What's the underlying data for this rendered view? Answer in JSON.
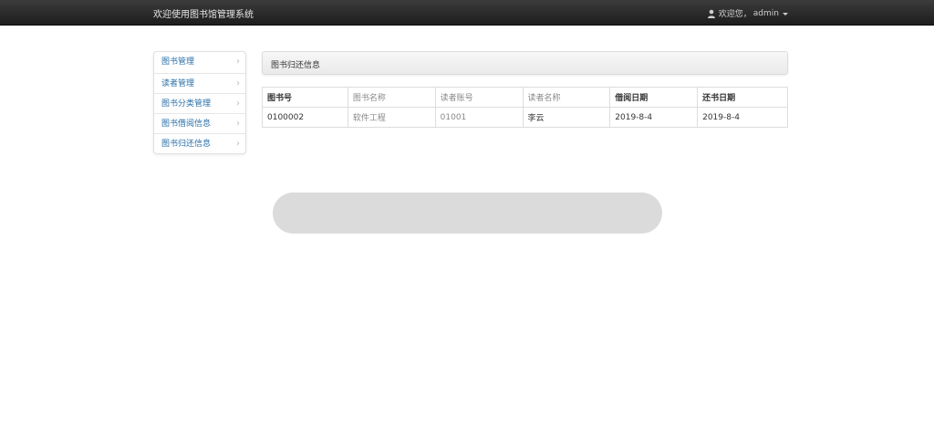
{
  "navbar": {
    "brand": "欢迎使用图书馆管理系统",
    "user_greeting": "欢迎您，",
    "user_name": "admin"
  },
  "sidebar": {
    "items": [
      {
        "label": "图书管理"
      },
      {
        "label": "读者管理"
      },
      {
        "label": "图书分类管理"
      },
      {
        "label": "图书借阅信息"
      },
      {
        "label": "图书归还信息"
      }
    ]
  },
  "panel": {
    "title": "图书归还信息"
  },
  "table": {
    "headers": [
      "图书号",
      "图书名称",
      "读者账号",
      "读者名称",
      "借阅日期",
      "还书日期"
    ],
    "rows": [
      [
        "0100002",
        "软件工程",
        "01001",
        "李云",
        "2019-8-4",
        "2019-8-4"
      ]
    ]
  },
  "colors": {
    "navbar_bg": "#262626",
    "link": "#2a6fa8",
    "border": "#dddddd"
  }
}
